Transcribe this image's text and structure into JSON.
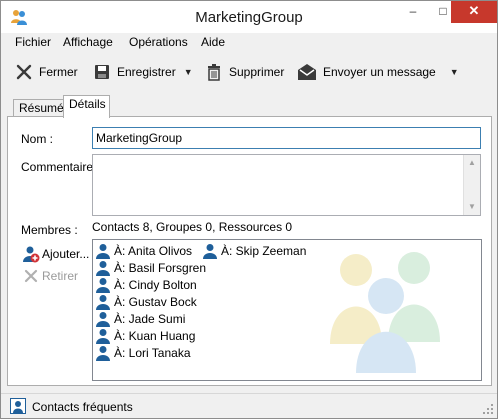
{
  "window": {
    "title": "MarketingGroup"
  },
  "menu": [
    "Fichier",
    "Affichage",
    "Opérations",
    "Aide"
  ],
  "toolbar": {
    "close_label": "Fermer",
    "save_label": "Enregistrer",
    "delete_label": "Supprimer",
    "send_label": "Envoyer un message"
  },
  "tabs": [
    "Résumé",
    "Détails"
  ],
  "active_tab": "Détails",
  "form": {
    "name_label": "Nom :",
    "name_value": "MarketingGroup",
    "comments_label": "Commentaires :",
    "comments_value": "",
    "members_label": "Membres :",
    "members_summary": "Contacts 8, Groupes 0, Ressources 0",
    "add_label": "Ajouter...",
    "remove_label": "Retirer"
  },
  "members": [
    "À: Anita Olivos",
    "À: Skip Zeeman",
    "À: Basil Forsgren",
    "À: Cindy Bolton",
    "À: Gustav Bock",
    "À: Jade Sumi",
    "À: Kuan Huang",
    "À: Lori Tanaka"
  ],
  "status": {
    "text": "Contacts fréquents"
  },
  "colors": {
    "close_button": "#c7382c",
    "contact_icon": "#1f5f9a",
    "input_border": "#3c7fb1",
    "window_bg": "#f0f0f0"
  }
}
